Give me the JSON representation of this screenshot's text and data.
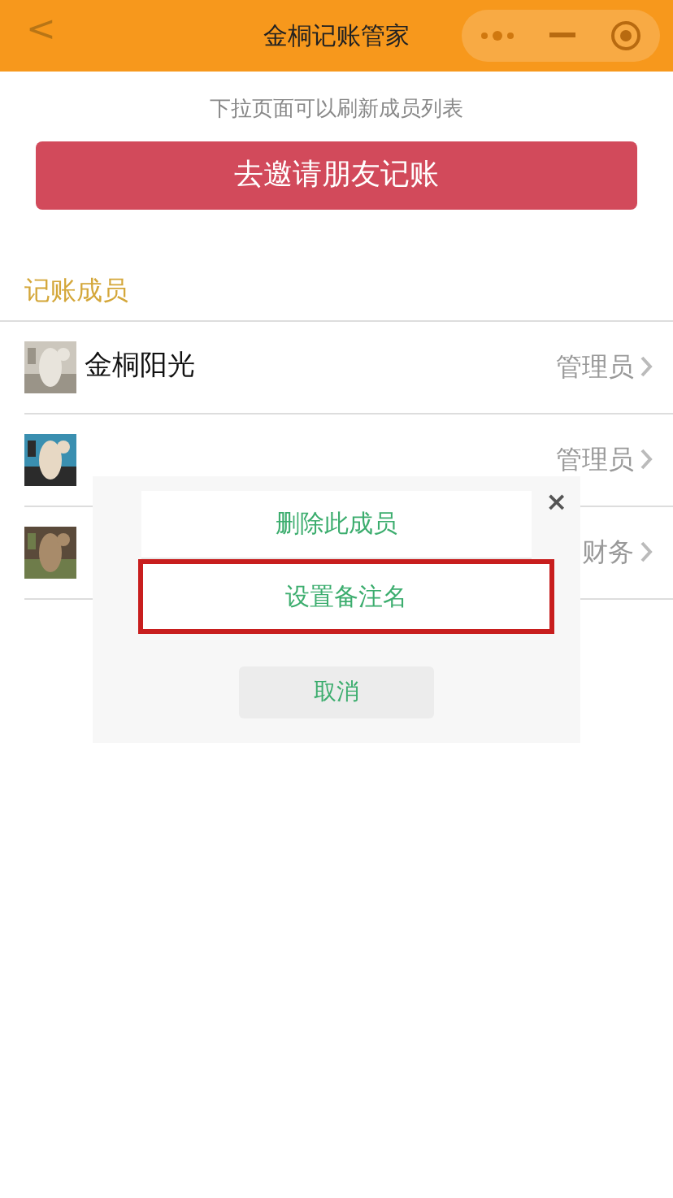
{
  "window": {
    "title": "金桐记账管家",
    "back": "<"
  },
  "hint": "下拉页面可以刷新成员列表",
  "invite_button": "去邀请朋友记账",
  "section_title": "记账成员",
  "members": [
    {
      "name": "金桐阳光",
      "role": "管理员"
    },
    {
      "role": "管理员"
    },
    {
      "role": "财务"
    }
  ],
  "dialog": {
    "close": "×",
    "actions": [
      {
        "label": "删除此成员",
        "highlighted": false
      },
      {
        "label": "设置备注名",
        "highlighted": true
      }
    ],
    "cancel": "取消"
  }
}
